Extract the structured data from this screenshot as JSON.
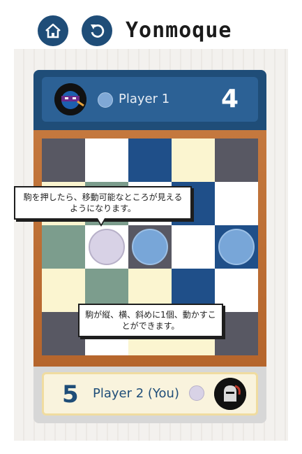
{
  "app": {
    "title": "Yonmoque"
  },
  "nav": {
    "home_icon": "home-icon",
    "restart_icon": "restart-icon"
  },
  "player1": {
    "name": "Player 1",
    "score": "4",
    "color": "#78a6d8",
    "avatar": "ninja-avatar"
  },
  "player2": {
    "name": "Player 2 (You)",
    "score": "5",
    "color": "#d8d2e6",
    "avatar": "knight-avatar"
  },
  "colors": {
    "dark": "#585863",
    "white": "#ffffff",
    "blue": "#1f4f89",
    "cream": "#fbf5d0",
    "green": "#7c9d8d",
    "frame": "#c0723a",
    "header": "#1f4d78"
  },
  "board": {
    "cells": [
      [
        "dark",
        "white",
        "blue",
        "cream",
        "dark"
      ],
      [
        "cream",
        "green",
        "white",
        "blue",
        "white"
      ],
      [
        "green",
        "white",
        "dark",
        "white",
        "blue"
      ],
      [
        "cream",
        "green",
        "cream",
        "blue",
        "white"
      ],
      [
        "dark",
        "white",
        "cream",
        "cream",
        "dark"
      ]
    ],
    "pieces": [
      {
        "row": 2,
        "col": 1,
        "owner": "p2"
      },
      {
        "row": 2,
        "col": 2,
        "owner": "p1"
      },
      {
        "row": 2,
        "col": 4,
        "owner": "p1"
      }
    ]
  },
  "tips": {
    "tip1": "駒を押したら、移動可能なところが見えるようになります。",
    "tip2": "駒が縦、横、斜めに1個、動かすことができます。"
  }
}
